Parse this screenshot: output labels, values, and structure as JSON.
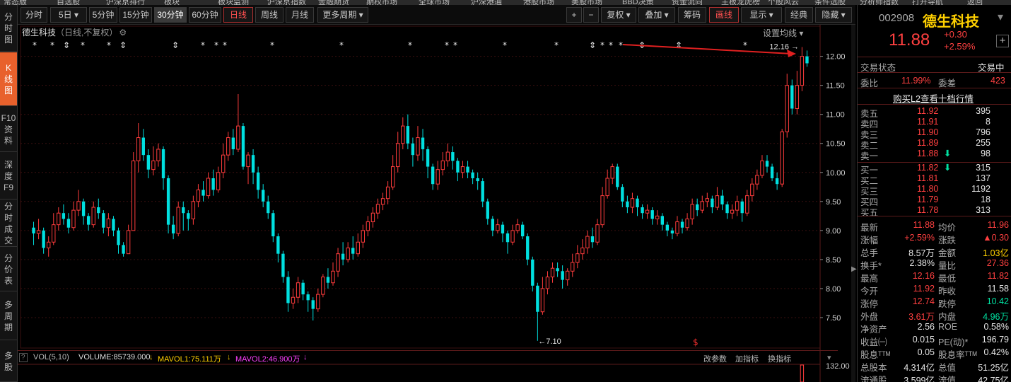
{
  "top_menu": [
    "常态版",
    "自选股",
    "沪深京排行",
    "板块",
    "板块监测",
    "沪深京指数",
    "金融期货",
    "期权市场",
    "全球市场",
    "沪深港通",
    "港股市场",
    "美股市场",
    "BBD决策",
    "资金流向",
    "主板龙虎榜",
    "个股风云",
    "条件选股",
    "分析师指数",
    "打开导航",
    "返回"
  ],
  "left_nav": [
    {
      "id": "fenshi",
      "label": "分时图"
    },
    {
      "id": "kline",
      "label": "K线图"
    },
    {
      "id": "f10",
      "label": "F10资料"
    },
    {
      "id": "depth",
      "label": "深度F9"
    },
    {
      "id": "tick",
      "label": "分时成交"
    },
    {
      "id": "price",
      "label": "分价表"
    },
    {
      "id": "multi",
      "label": "多周期"
    },
    {
      "id": "multistock",
      "label": "多股"
    }
  ],
  "toolbar": {
    "b1": "分时",
    "b2": "5日 ▾",
    "b3": "5分钟",
    "b4": "15分钟",
    "b5": "30分钟",
    "b6": "60分钟",
    "b7": "日线",
    "b8": "周线",
    "b9": "月线",
    "b10": "更多周期 ▾",
    "plus": "+",
    "minus": "−",
    "fq": "复权 ▾",
    "overlay": "叠加 ▾",
    "chips": "筹码",
    "draw": "画线",
    "display": "显示 ▾",
    "classic": "经典",
    "hide": "隐藏 ▾"
  },
  "chart_header": {
    "name": "德生科技",
    "sub": "（日线,不复权）",
    "ma_setting": "设置均线 ▾"
  },
  "chart_data": {
    "type": "candlestick",
    "ylim": [
      7.0,
      12.3
    ],
    "yticks": [
      "12.00",
      "11.50",
      "11.00",
      "10.50",
      "10.00",
      "9.50",
      "9.00",
      "8.50",
      "8.00",
      "7.50"
    ],
    "high_label": "12.16",
    "low_label": "←7.10",
    "colors": {
      "up": "#ff3c3c",
      "down": "#00e0e0",
      "grid": "#3a0f0f",
      "axis": "#d0d0d0"
    },
    "ohlc": [
      [
        9.05,
        8.95,
        9.15,
        8.75
      ],
      [
        8.95,
        9.0,
        9.2,
        8.85
      ],
      [
        9.0,
        8.7,
        9.05,
        8.6
      ],
      [
        8.7,
        8.8,
        8.9,
        8.55
      ],
      [
        8.8,
        9.1,
        9.3,
        8.75
      ],
      [
        9.1,
        9.3,
        9.4,
        9.0
      ],
      [
        9.3,
        9.2,
        9.45,
        9.1
      ],
      [
        9.2,
        9.05,
        9.3,
        8.95
      ],
      [
        9.05,
        9.35,
        9.5,
        9.0
      ],
      [
        9.35,
        9.5,
        9.7,
        9.25
      ],
      [
        9.5,
        9.25,
        9.55,
        9.1
      ],
      [
        9.25,
        9.1,
        9.3,
        9.0
      ],
      [
        9.1,
        9.4,
        9.5,
        9.05
      ],
      [
        9.4,
        9.3,
        9.55,
        9.2
      ],
      [
        9.3,
        9.05,
        9.35,
        8.95
      ],
      [
        9.05,
        9.2,
        9.3,
        8.9
      ],
      [
        9.2,
        9.0,
        9.25,
        8.9
      ],
      [
        9.0,
        8.75,
        9.05,
        8.6
      ],
      [
        8.75,
        8.6,
        8.8,
        8.55
      ],
      [
        8.6,
        9.0,
        9.1,
        8.6
      ],
      [
        9.0,
        10.2,
        10.35,
        9.0
      ],
      [
        10.2,
        10.6,
        10.85,
        10.0
      ],
      [
        10.6,
        10.3,
        10.75,
        10.2
      ],
      [
        10.3,
        10.05,
        10.4,
        9.9
      ],
      [
        10.05,
        10.2,
        10.45,
        9.95
      ],
      [
        10.2,
        10.4,
        10.5,
        10.1
      ],
      [
        10.4,
        9.9,
        10.45,
        9.7
      ],
      [
        9.9,
        9.1,
        9.95,
        8.95
      ],
      [
        9.1,
        8.95,
        9.25,
        8.85
      ],
      [
        8.95,
        9.4,
        9.5,
        8.9
      ],
      [
        9.4,
        9.3,
        9.5,
        9.0
      ],
      [
        9.3,
        9.2,
        9.35,
        9.0
      ],
      [
        9.2,
        9.5,
        9.6,
        9.1
      ],
      [
        9.5,
        9.7,
        9.8,
        9.4
      ],
      [
        9.7,
        9.6,
        9.85,
        9.5
      ],
      [
        9.6,
        9.9,
        10.0,
        9.55
      ],
      [
        9.9,
        9.7,
        10.05,
        9.6
      ],
      [
        9.7,
        10.0,
        10.1,
        9.65
      ],
      [
        10.0,
        10.3,
        10.5,
        9.9
      ],
      [
        10.3,
        10.6,
        10.7,
        10.2
      ],
      [
        10.6,
        10.4,
        10.75,
        10.3
      ],
      [
        10.4,
        10.8,
        11.35,
        10.35
      ],
      [
        10.8,
        10.1,
        10.85,
        10.05
      ],
      [
        10.1,
        10.3,
        10.35,
        9.8
      ],
      [
        10.3,
        10.0,
        10.4,
        9.8
      ],
      [
        10.0,
        9.7,
        10.1,
        9.55
      ],
      [
        9.7,
        9.5,
        9.8,
        9.4
      ],
      [
        9.5,
        9.3,
        9.6,
        9.2
      ],
      [
        9.3,
        8.9,
        9.35,
        8.8
      ],
      [
        8.9,
        8.6,
        8.95,
        8.45
      ],
      [
        8.6,
        8.2,
        8.65,
        8.1
      ],
      [
        8.2,
        7.75,
        8.3,
        7.6
      ],
      [
        7.75,
        7.85,
        8.0,
        7.65
      ],
      [
        7.85,
        8.1,
        8.2,
        7.75
      ],
      [
        8.1,
        7.9,
        8.15,
        7.8
      ],
      [
        7.9,
        7.8,
        7.95,
        7.6
      ],
      [
        7.8,
        7.65,
        7.85,
        7.45
      ],
      [
        7.65,
        7.9,
        8.0,
        7.6
      ],
      [
        7.9,
        8.2,
        8.25,
        7.85
      ],
      [
        8.2,
        8.1,
        8.35,
        8.0
      ],
      [
        8.1,
        8.3,
        8.45,
        8.05
      ],
      [
        8.3,
        8.6,
        8.7,
        8.2
      ],
      [
        8.6,
        8.5,
        8.8,
        8.4
      ],
      [
        8.5,
        8.7,
        8.8,
        8.45
      ],
      [
        8.7,
        8.6,
        8.9,
        8.5
      ],
      [
        8.6,
        8.8,
        8.95,
        8.55
      ],
      [
        8.8,
        9.0,
        9.1,
        8.7
      ],
      [
        9.0,
        9.15,
        9.25,
        8.9
      ],
      [
        9.15,
        9.3,
        9.4,
        9.05
      ],
      [
        9.3,
        9.45,
        9.55,
        9.2
      ],
      [
        9.45,
        9.55,
        9.65,
        9.35
      ],
      [
        9.55,
        9.75,
        9.85,
        9.45
      ],
      [
        9.75,
        10.1,
        10.3,
        9.7
      ],
      [
        10.1,
        10.5,
        10.7,
        10.0
      ],
      [
        10.5,
        10.8,
        10.95,
        10.4
      ],
      [
        10.8,
        10.5,
        11.0,
        10.4
      ],
      [
        10.5,
        10.3,
        10.6,
        10.1
      ],
      [
        10.3,
        10.6,
        10.8,
        10.2
      ],
      [
        10.6,
        10.4,
        10.75,
        10.2
      ],
      [
        10.4,
        10.1,
        10.45,
        9.9
      ],
      [
        10.1,
        9.8,
        10.15,
        9.7
      ],
      [
        9.8,
        10.05,
        10.2,
        9.7
      ],
      [
        10.05,
        10.2,
        10.35,
        9.95
      ],
      [
        10.2,
        10.35,
        10.5,
        10.1
      ],
      [
        10.35,
        10.2,
        10.45,
        10.05
      ],
      [
        10.2,
        10.0,
        10.25,
        9.85
      ],
      [
        10.0,
        10.1,
        10.2,
        9.9
      ],
      [
        10.1,
        10.0,
        10.2,
        9.9
      ],
      [
        10.0,
        9.9,
        10.05,
        9.8
      ],
      [
        9.9,
        9.85,
        10.0,
        9.7
      ],
      [
        9.85,
        9.5,
        9.9,
        9.4
      ],
      [
        9.5,
        9.2,
        9.55,
        9.1
      ],
      [
        9.2,
        9.0,
        9.25,
        8.9
      ],
      [
        9.0,
        9.1,
        9.2,
        8.95
      ],
      [
        9.1,
        8.95,
        9.15,
        8.8
      ],
      [
        8.95,
        8.8,
        9.0,
        8.6
      ],
      [
        8.8,
        9.0,
        9.1,
        8.75
      ],
      [
        9.0,
        9.1,
        9.2,
        8.95
      ],
      [
        9.1,
        8.9,
        9.15,
        8.85
      ],
      [
        8.9,
        8.5,
        8.95,
        8.4
      ],
      [
        8.5,
        8.05,
        8.55,
        7.95
      ],
      [
        8.05,
        7.6,
        8.1,
        7.1
      ],
      [
        7.6,
        8.0,
        8.2,
        7.55
      ],
      [
        8.0,
        8.2,
        8.3,
        7.9
      ],
      [
        8.2,
        8.35,
        8.45,
        8.1
      ],
      [
        8.35,
        8.3,
        8.45,
        8.2
      ],
      [
        8.3,
        8.15,
        8.4,
        8.0
      ],
      [
        8.15,
        8.3,
        8.35,
        8.05
      ],
      [
        8.3,
        8.45,
        8.6,
        8.2
      ],
      [
        8.45,
        8.6,
        8.75,
        8.35
      ],
      [
        8.6,
        8.7,
        8.85,
        8.5
      ],
      [
        8.7,
        8.9,
        9.0,
        8.6
      ],
      [
        8.9,
        8.8,
        9.05,
        8.7
      ],
      [
        8.8,
        9.1,
        9.2,
        8.75
      ],
      [
        9.1,
        9.6,
        9.75,
        9.05
      ],
      [
        9.6,
        9.9,
        10.05,
        9.55
      ],
      [
        9.9,
        10.1,
        10.15,
        9.8
      ],
      [
        10.1,
        9.75,
        10.15,
        9.7
      ],
      [
        9.75,
        9.5,
        9.8,
        9.4
      ],
      [
        9.5,
        9.4,
        9.6,
        9.3
      ],
      [
        9.4,
        9.55,
        9.65,
        9.3
      ],
      [
        9.55,
        9.4,
        9.6,
        9.25
      ],
      [
        9.4,
        9.3,
        9.45,
        9.2
      ],
      [
        9.3,
        9.35,
        9.45,
        9.2
      ],
      [
        9.35,
        9.2,
        9.4,
        9.1
      ],
      [
        9.2,
        9.25,
        9.35,
        9.1
      ],
      [
        9.25,
        9.1,
        9.3,
        9.0
      ],
      [
        9.1,
        9.0,
        9.15,
        8.9
      ],
      [
        9.0,
        8.95,
        9.05,
        8.85
      ],
      [
        8.95,
        9.15,
        9.25,
        8.9
      ],
      [
        9.15,
        9.05,
        9.2,
        8.95
      ],
      [
        9.05,
        9.2,
        9.3,
        9.0
      ],
      [
        9.2,
        9.45,
        9.55,
        9.1
      ],
      [
        9.45,
        9.35,
        9.55,
        9.25
      ],
      [
        9.35,
        9.5,
        9.6,
        9.3
      ],
      [
        9.5,
        9.55,
        9.65,
        9.4
      ],
      [
        9.55,
        9.4,
        9.6,
        9.3
      ],
      [
        9.4,
        9.6,
        9.75,
        9.35
      ],
      [
        9.6,
        9.45,
        9.7,
        9.35
      ],
      [
        9.45,
        9.3,
        9.5,
        9.2
      ],
      [
        9.3,
        9.35,
        9.45,
        9.2
      ],
      [
        9.35,
        9.5,
        9.6,
        9.25
      ],
      [
        9.5,
        9.3,
        9.55,
        9.15
      ],
      [
        9.3,
        9.6,
        9.7,
        9.25
      ],
      [
        9.6,
        9.8,
        9.9,
        9.5
      ],
      [
        9.8,
        9.95,
        10.05,
        9.7
      ],
      [
        9.95,
        10.2,
        10.3,
        9.9
      ],
      [
        10.2,
        10.1,
        10.3,
        10.0
      ],
      [
        10.1,
        9.9,
        10.15,
        9.85
      ],
      [
        9.9,
        9.8,
        10.0,
        9.7
      ],
      [
        9.8,
        10.7,
        10.75,
        9.75
      ],
      [
        10.7,
        11.5,
        11.7,
        10.6
      ],
      [
        11.5,
        11.1,
        11.6,
        11.0
      ],
      [
        11.1,
        11.5,
        11.75,
        11.0
      ],
      [
        11.5,
        12.0,
        12.16,
        11.4
      ],
      [
        12.0,
        11.88,
        12.1,
        11.82
      ]
    ],
    "markers": [
      "*",
      "*",
      "⇕",
      "*",
      "*",
      "⇕",
      "⇕",
      "*",
      "**",
      "*",
      "*",
      "*",
      "**",
      "*",
      "*",
      "⇕",
      "***",
      "⇕",
      "⇕",
      "*",
      "*"
    ]
  },
  "volume_bar": {
    "label": "VOL(5,10)",
    "volume": "VOLUME:85739.000",
    "mavol1": "MAVOL1:75.111万",
    "mavol2": "MAVOL2:46.900万",
    "change_param": "改参数",
    "add_indicator": "加指标",
    "switch_indicator": "换指标",
    "vol_tick": "132.00"
  },
  "quote": {
    "code": "002908",
    "name": "德生科技",
    "price": "11.88",
    "change": "+0.30",
    "change_pct": "+2.59%",
    "status_label": "交易状态",
    "status_value": "交易中",
    "wb_label": "委比",
    "wb_value": "11.99%",
    "wc_label": "委差",
    "wc_value": "423",
    "l2_link": "购买L2查看十档行情",
    "sells": [
      [
        "卖五",
        "11.92",
        "395"
      ],
      [
        "卖四",
        "11.91",
        "8"
      ],
      [
        "卖三",
        "11.90",
        "796"
      ],
      [
        "卖二",
        "11.89",
        "255"
      ],
      [
        "卖一",
        "11.88",
        "98"
      ]
    ],
    "buys": [
      [
        "买一",
        "11.82",
        "315"
      ],
      [
        "买二",
        "11.81",
        "137"
      ],
      [
        "买三",
        "11.80",
        "1192"
      ],
      [
        "买四",
        "11.79",
        "18"
      ],
      [
        "买五",
        "11.78",
        "313"
      ]
    ],
    "stats": [
      [
        "最新",
        "11.88",
        "red",
        "均价",
        "11.96",
        "red"
      ],
      [
        "涨幅",
        "+2.59%",
        "red",
        "涨跌",
        "▲0.30",
        "red"
      ],
      [
        "总手",
        "8.57万",
        "wht",
        "金额",
        "1.03亿",
        "yel"
      ],
      [
        "换手*",
        "2.38%",
        "wht",
        "量比",
        "27.36",
        "red"
      ],
      [
        "最高",
        "12.16",
        "red",
        "最低",
        "11.82",
        "red"
      ],
      [
        "今开",
        "11.92",
        "red",
        "昨收",
        "11.58",
        "wht"
      ],
      [
        "涨停",
        "12.74",
        "red",
        "跌停",
        "10.42",
        "grn"
      ],
      [
        "外盘",
        "3.61万",
        "red",
        "内盘",
        "4.96万",
        "grn"
      ],
      [
        "净资产",
        "2.56",
        "wht",
        "ROE",
        "0.58%",
        "wht"
      ],
      [
        "收益㈠",
        "0.015",
        "wht",
        "PE(动)*",
        "196.79",
        "wht"
      ],
      [
        "股息ᵀᵀᴹ",
        "0.05",
        "wht",
        "股息率ᵀᵀᴹ",
        "0.42%",
        "wht"
      ],
      [
        "总股本",
        "4.314亿",
        "wht",
        "总值",
        "51.25亿",
        "wht"
      ],
      [
        "流通股",
        "3.599亿",
        "wht",
        "流值",
        "42.75亿",
        "wht"
      ]
    ]
  }
}
